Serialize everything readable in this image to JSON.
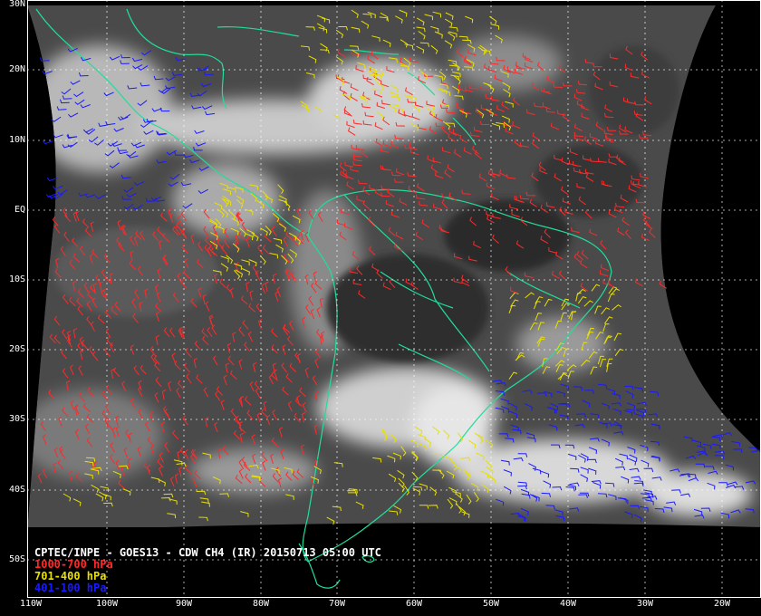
{
  "title": "CPTEC/INPE - GOES13 - CDW CH4 (IR) 20150713 05:00 UTC",
  "legend": [
    {
      "label": "1000-700 hPa",
      "color": "#ff2a2a"
    },
    {
      "label": "701-400 hPa",
      "color": "#e8e000"
    },
    {
      "label": "401-100 hPa",
      "color": "#1a1aff"
    }
  ],
  "lat_labels": [
    "30N",
    "20N",
    "10N",
    "EQ",
    "10S",
    "20S",
    "30S",
    "40S",
    "50S"
  ],
  "lon_labels": [
    "110W",
    "100W",
    "90W",
    "80W",
    "70W",
    "60W",
    "50W",
    "40W",
    "30W",
    "20W"
  ],
  "colors": {
    "background": "#000000",
    "coastline": "#22dd99",
    "grid": "#ffffff",
    "text": "#ffffff"
  }
}
